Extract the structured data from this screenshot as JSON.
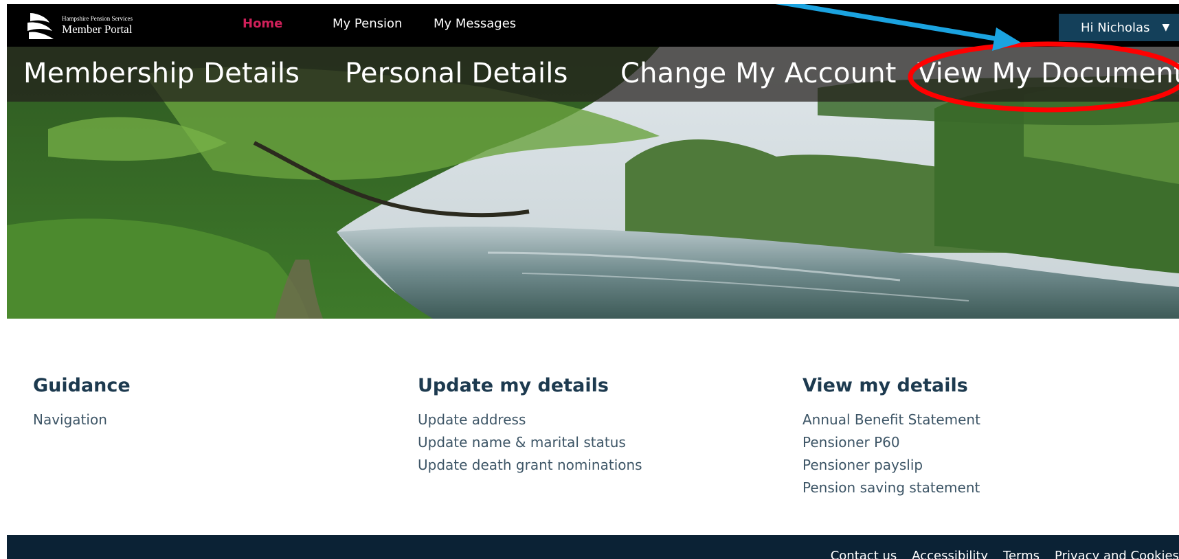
{
  "brand": {
    "small_text": "Hampshire Pension Services",
    "big_text": "Member Portal"
  },
  "nav": {
    "home": "Home",
    "my_pension": "My Pension",
    "my_messages": "My Messages",
    "user_greeting": "Hi Nicholas",
    "active_color": "#d0205a"
  },
  "hero_tabs": {
    "membership": "Membership Details",
    "personal": "Personal Details",
    "change_account": "Change My Account",
    "view_documents": "View My Documents"
  },
  "annotation": {
    "circle_color": "#ff0000",
    "arrow_color": "#1ba3e0"
  },
  "guidance": {
    "title": "Guidance",
    "links": [
      "Navigation"
    ]
  },
  "update_details": {
    "title": "Update my details",
    "links": [
      "Update address",
      "Update name & marital status",
      "Update death grant nominations"
    ]
  },
  "view_details": {
    "title": "View my details",
    "links": [
      "Annual Benefit Statement",
      "Pensioner P60",
      "Pensioner payslip",
      "Pension saving statement"
    ]
  },
  "footer": {
    "links": [
      "Contact us",
      "Accessibility",
      "Terms",
      "Privacy and Cookies"
    ]
  },
  "colors": {
    "topbar": "#000000",
    "footer": "#0b2235",
    "heading": "#1d3a4f",
    "user_button": "#14405a"
  }
}
